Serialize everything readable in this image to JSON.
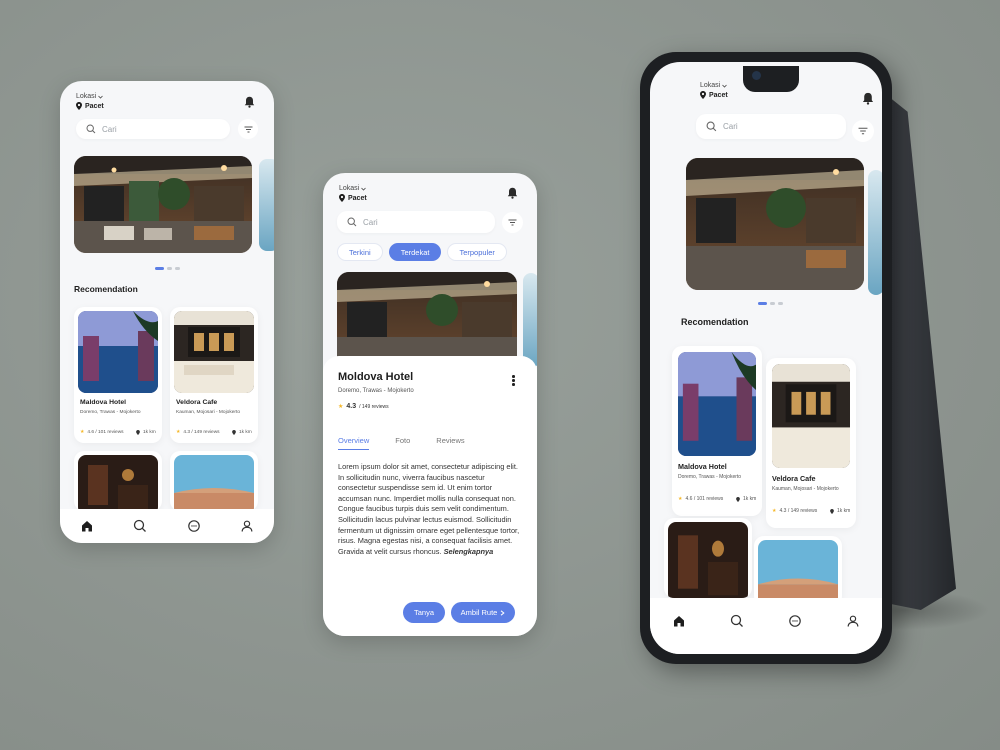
{
  "location": {
    "label": "Lokasi",
    "value": "Pacet"
  },
  "search": {
    "placeholder": "Cari"
  },
  "section": {
    "recommendation": "Recomendation"
  },
  "cards": [
    {
      "name": "Maldova Hotel",
      "address": "Doremo, Trawas - Mojokerto",
      "rating": "4.6 / 101 reviews",
      "distance": "1k km"
    },
    {
      "name": "Veldora Cafe",
      "address": "Kauman, Mojosari - Mojokerto",
      "rating": "4.3 / 149 reviews",
      "distance": "1k km"
    }
  ],
  "filter_tabs": [
    "Terkini",
    "Terdekat",
    "Terpopuler"
  ],
  "detail": {
    "title": "Moldova Hotel",
    "address": "Doremo, Trawas - Mojokerto",
    "rating_value": "4.3",
    "rating_reviews": "/ 149 reviews",
    "tabs": [
      "Overview",
      "Foto",
      "Reviews"
    ],
    "description": "Lorem ipsum dolor sit amet, consectetur adipiscing elit. In sollicitudin nunc, viverra faucibus nascetur consectetur suspendisse sem id. Ut enim tortor accumsan nunc. Imperdiet mollis nulla consequat non. Congue faucibus turpis duis sem velit condimentum. Sollicitudin lacus pulvinar lectus euismod. Sollicitudin fermentum ut dignissim ornare eget pellentesque tortor, risus. Magna egestas nisi, a consequat facilisis amet. Gravida at velit cursus rhoncus.",
    "read_more": "Selengkapnya",
    "ask_button": "Tanya",
    "route_button": "Ambil Rute"
  },
  "colors": {
    "accent": "#5b7ee5",
    "background": "#8e9590",
    "screen": "#f6f7f9"
  },
  "icons": [
    "map-pin-icon",
    "bell-icon",
    "search-icon",
    "filter-icon",
    "star-icon",
    "home-icon",
    "chat-icon",
    "user-icon",
    "kebab-menu-icon",
    "chevron-right-icon"
  ]
}
